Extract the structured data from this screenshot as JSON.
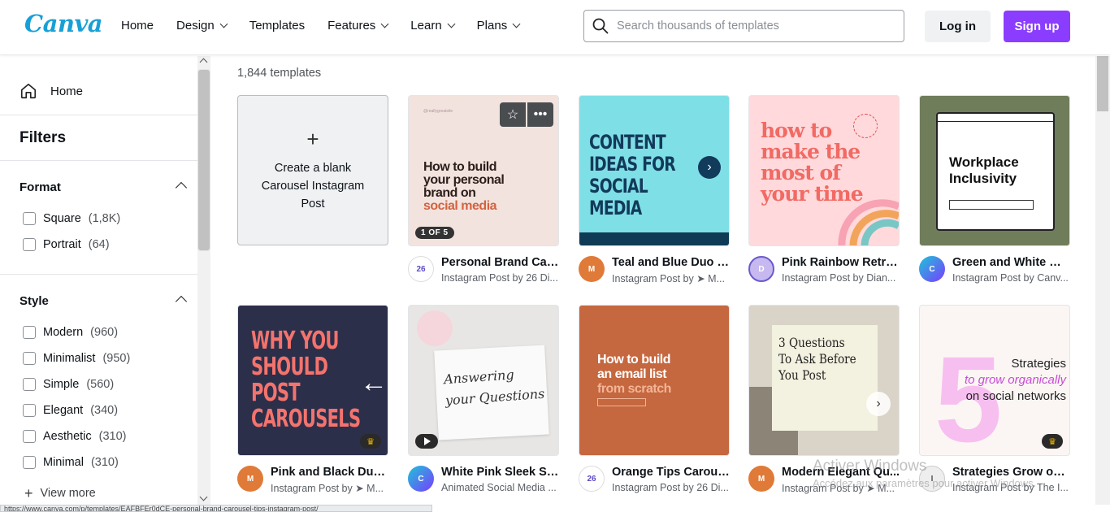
{
  "brand": {
    "logo": "Canva",
    "logo_color": "#18a0d6",
    "accent": "#8b3dff"
  },
  "nav": [
    {
      "label": "Home",
      "dropdown": false
    },
    {
      "label": "Design",
      "dropdown": true
    },
    {
      "label": "Templates",
      "dropdown": false
    },
    {
      "label": "Features",
      "dropdown": true
    },
    {
      "label": "Learn",
      "dropdown": true
    },
    {
      "label": "Plans",
      "dropdown": true
    }
  ],
  "search": {
    "placeholder": "Search thousands of templates"
  },
  "auth": {
    "login": "Log in",
    "signup": "Sign up"
  },
  "sidebar": {
    "home": "Home",
    "filters_title": "Filters",
    "format": {
      "title": "Format",
      "options": [
        {
          "label": "Square",
          "count": "(1,8K)"
        },
        {
          "label": "Portrait",
          "count": "(64)"
        }
      ]
    },
    "style": {
      "title": "Style",
      "options": [
        {
          "label": "Modern",
          "count": "(960)"
        },
        {
          "label": "Minimalist",
          "count": "(950)"
        },
        {
          "label": "Simple",
          "count": "(560)"
        },
        {
          "label": "Elegant",
          "count": "(340)"
        },
        {
          "label": "Aesthetic",
          "count": "(310)"
        },
        {
          "label": "Minimal",
          "count": "(310)"
        }
      ]
    },
    "view_more": "View more"
  },
  "main": {
    "count": "1,844 templates",
    "blank_card": "Create a blank Carousel Instagram Post",
    "templates": [
      {
        "title": "Personal Brand Car...",
        "subtitle": "Instagram Post by 26 Di...",
        "thumb_text": [
          "How to build",
          "your personal",
          "brand on",
          "social media"
        ],
        "badge": "1 OF 5"
      },
      {
        "title": "Teal and Blue Duo T...",
        "subtitle": "Instagram Post by ➤ M...",
        "thumb_text": [
          "CONTENT",
          "IDEAS FOR",
          "SOCIAL MEDIA"
        ]
      },
      {
        "title": "Pink Rainbow Retro...",
        "subtitle": "Instagram Post by Dian...",
        "thumb_text": [
          "how to",
          "make the",
          "most of",
          "your time"
        ]
      },
      {
        "title": "Green and White Mi...",
        "subtitle": "Instagram Post by Canv...",
        "thumb_text": [
          "Workplace",
          "Inclusivity"
        ]
      },
      {
        "title": "Pink and Black Duo ...",
        "subtitle": "Instagram Post by ➤ M...",
        "thumb_text": [
          "WHY YOU",
          "SHOULD",
          "POST",
          "CAROUSELS"
        ]
      },
      {
        "title": "White Pink Sleek Sc...",
        "subtitle": "Animated Social Media ...",
        "thumb_text": [
          "Answering",
          "your Questions"
        ]
      },
      {
        "title": "Orange Tips Carous...",
        "subtitle": "Instagram Post by 26 Di...",
        "thumb_text": [
          "How to build",
          "an email list",
          "from scratch"
        ]
      },
      {
        "title": "Modern Elegant Qu...",
        "subtitle": "Instagram Post by ➤ M...",
        "thumb_text": [
          "3 Questions",
          "To Ask Before",
          "You Post"
        ]
      },
      {
        "title": "Strategies Grow on ...",
        "subtitle": "Instagram Post by The I...",
        "thumb_text": [
          "Strategies",
          "to grow organically",
          "on social networks"
        ]
      }
    ]
  },
  "statusbar": "https://www.canva.com/p/templates/EAFBFEr0dCE-personal-brand-carousel-tips-instagram-post/",
  "watermark": {
    "line1": "Activer Windows",
    "line2": "Accédez aux paramètres pour activer Windows."
  }
}
